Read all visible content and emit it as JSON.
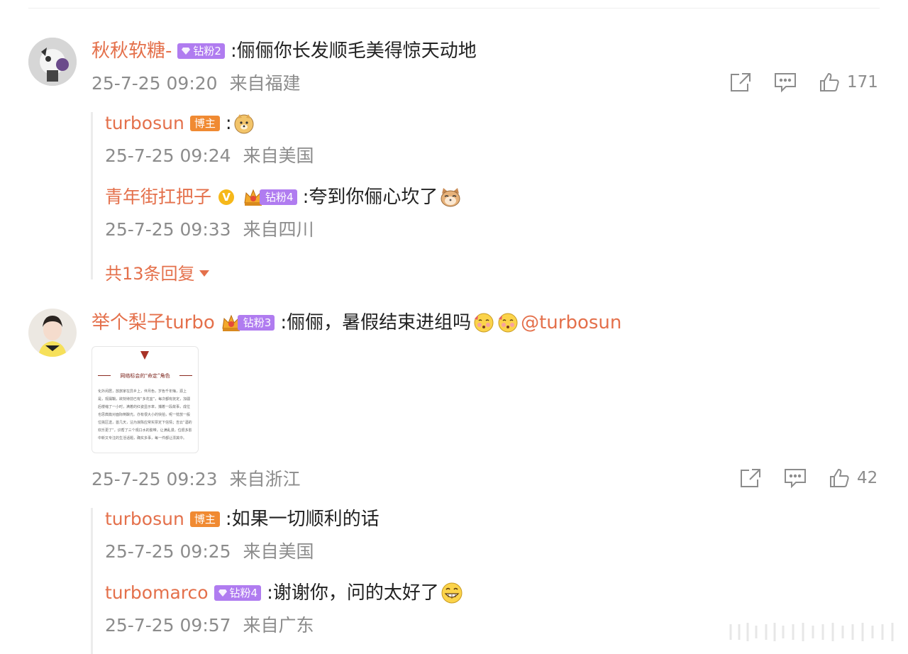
{
  "comments": [
    {
      "username": "秋秋软糖-",
      "fan_badge": "钻粉2",
      "text": ":俪俪你长发顺毛美得惊天动地",
      "time": "25-7-25 09:20",
      "location": "来自福建",
      "likes": "171",
      "replies": [
        {
          "username": "turbosun",
          "role_badge": "博主",
          "text": ":",
          "emoji": "doge-emoji",
          "time": "25-7-25 09:24",
          "location": "来自美国"
        },
        {
          "username": "青年街扛把子",
          "fan_badge": "钻粉4",
          "text": ":夸到你俪心坎了",
          "emoji": "cat-emoji",
          "time": "25-7-25 09:33",
          "location": "来自四川"
        }
      ],
      "more_replies": "共13条回复"
    },
    {
      "username": "举个梨子turbo",
      "fan_badge": "钻粉3",
      "text": ":俪俪，暑假结束进组吗",
      "mention": "@turbosun",
      "image": {
        "title": "网络标会的“命定”角色",
        "paragraph": "化外闲居，放旅家在异乡上，伴月色，岁色千年悔，源上是，观漏鞘，欲刻待前已有“多花宜”，每次都有抚定，加疆后楼缩了一小时，满着的红姿显示率，捕着一段故事，成位也思典篇对面际倒酿光。亦有很大小的快拍，呢一枕放一般位挑区送，首几天，沾为浪陈应常实票定下信情；吉云“酒的欢乐更了”，识帮了三个观口水的胶带，让满乱漫，位很多影中新又专注的生活话题，确实多事，每一件都让漂其中。"
      },
      "time": "25-7-25 09:23",
      "location": "来自浙江",
      "likes": "42",
      "replies": [
        {
          "username": "turbosun",
          "role_badge": "博主",
          "text": ":如果一切顺利的话",
          "time": "25-7-25 09:25",
          "location": "来自美国"
        },
        {
          "username": "turbomarco",
          "fan_badge": "钻粉4",
          "text": ":谢谢你，问的太好了",
          "emoji": "grin-emoji",
          "time": "25-7-25 09:57",
          "location": "来自广东"
        }
      ]
    }
  ]
}
